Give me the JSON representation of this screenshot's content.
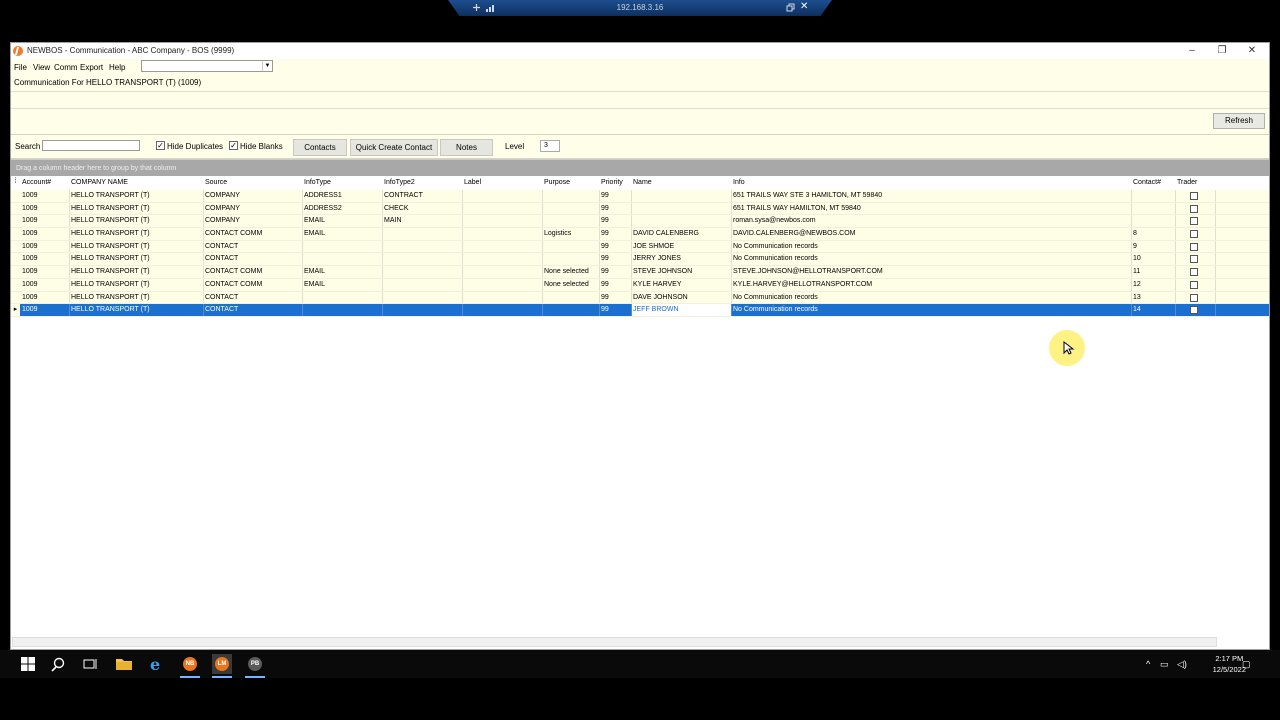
{
  "remote": {
    "ip": "192.168.3.16"
  },
  "window": {
    "title": "NEWBOS - Communication - ABC Company - BOS (9999)"
  },
  "menu": [
    "File",
    "View",
    "Comm",
    "Export",
    "Help"
  ],
  "comm_for": "Communication For HELLO TRANSPORT (T) (1009)",
  "toolbar": {
    "refresh": "Refresh",
    "search_label": "Search",
    "search_value": "",
    "hide_duplicates": "Hide Duplicates",
    "hide_blanks": "Hide Blanks",
    "contacts": "Contacts",
    "quick_create": "Quick Create Contact",
    "notes": "Notes",
    "level_label": "Level",
    "level_value": "3"
  },
  "group_panel": "Drag a column header here to group by that column",
  "grid": {
    "headers": [
      "Account#",
      "COMPANY NAME",
      "Source",
      "InfoType",
      "InfoType2",
      "Label",
      "Purpose",
      "Priority",
      "Name",
      "Info",
      "Contact#",
      "Trader"
    ],
    "rows": [
      [
        "1009",
        "HELLO TRANSPORT (T)",
        "COMPANY",
        "ADDRESS1",
        "CONTRACT",
        "",
        "",
        "99",
        "",
        "651 TRAILS WAY STE 3 HAMILTON, MT 59840",
        ""
      ],
      [
        "1009",
        "HELLO TRANSPORT (T)",
        "COMPANY",
        "ADDRESS2",
        "CHECK",
        "",
        "",
        "99",
        "",
        "651 TRAILS WAY HAMILTON, MT 59840",
        ""
      ],
      [
        "1009",
        "HELLO TRANSPORT (T)",
        "COMPANY",
        "EMAIL",
        "MAIN",
        "",
        "",
        "99",
        "",
        "roman.sysa@newbos.com",
        ""
      ],
      [
        "1009",
        "HELLO TRANSPORT (T)",
        "CONTACT COMM",
        "EMAIL",
        "",
        "",
        "Logistics",
        "99",
        "DAVID CALENBERG",
        "DAVID.CALENBERG@NEWBOS.COM",
        "8"
      ],
      [
        "1009",
        "HELLO TRANSPORT (T)",
        "CONTACT",
        "",
        "",
        "",
        "",
        "99",
        "JOE SHMOE",
        "No Communication records",
        "9"
      ],
      [
        "1009",
        "HELLO TRANSPORT (T)",
        "CONTACT",
        "",
        "",
        "",
        "",
        "99",
        "JERRY JONES",
        "No Communication records",
        "10"
      ],
      [
        "1009",
        "HELLO TRANSPORT (T)",
        "CONTACT COMM",
        "EMAIL",
        "",
        "",
        "None selected",
        "99",
        "STEVE JOHNSON",
        "STEVE.JOHNSON@HELLOTRANSPORT.COM",
        "11"
      ],
      [
        "1009",
        "HELLO TRANSPORT (T)",
        "CONTACT COMM",
        "EMAIL",
        "",
        "",
        "None selected",
        "99",
        "KYLE HARVEY",
        "KYLE.HARVEY@HELLOTRANSPORT.COM",
        "12"
      ],
      [
        "1009",
        "HELLO TRANSPORT (T)",
        "CONTACT",
        "",
        "",
        "",
        "",
        "99",
        "DAVE JOHNSON",
        "No Communication records",
        "13"
      ],
      [
        "1009",
        "HELLO TRANSPORT (T)",
        "CONTACT",
        "",
        "",
        "",
        "",
        "99",
        "JEFF BROWN",
        "No Communication records",
        "14"
      ]
    ],
    "selected_index": 9
  },
  "taskbar": {
    "apps": [
      "NB",
      "LM",
      "PB"
    ],
    "time": "2:17 PM",
    "date": "12/5/2022"
  },
  "colors": {
    "panel_bg": "#fffee8",
    "selection": "#1b6fcf",
    "group_panel": "#a8a8a8"
  }
}
